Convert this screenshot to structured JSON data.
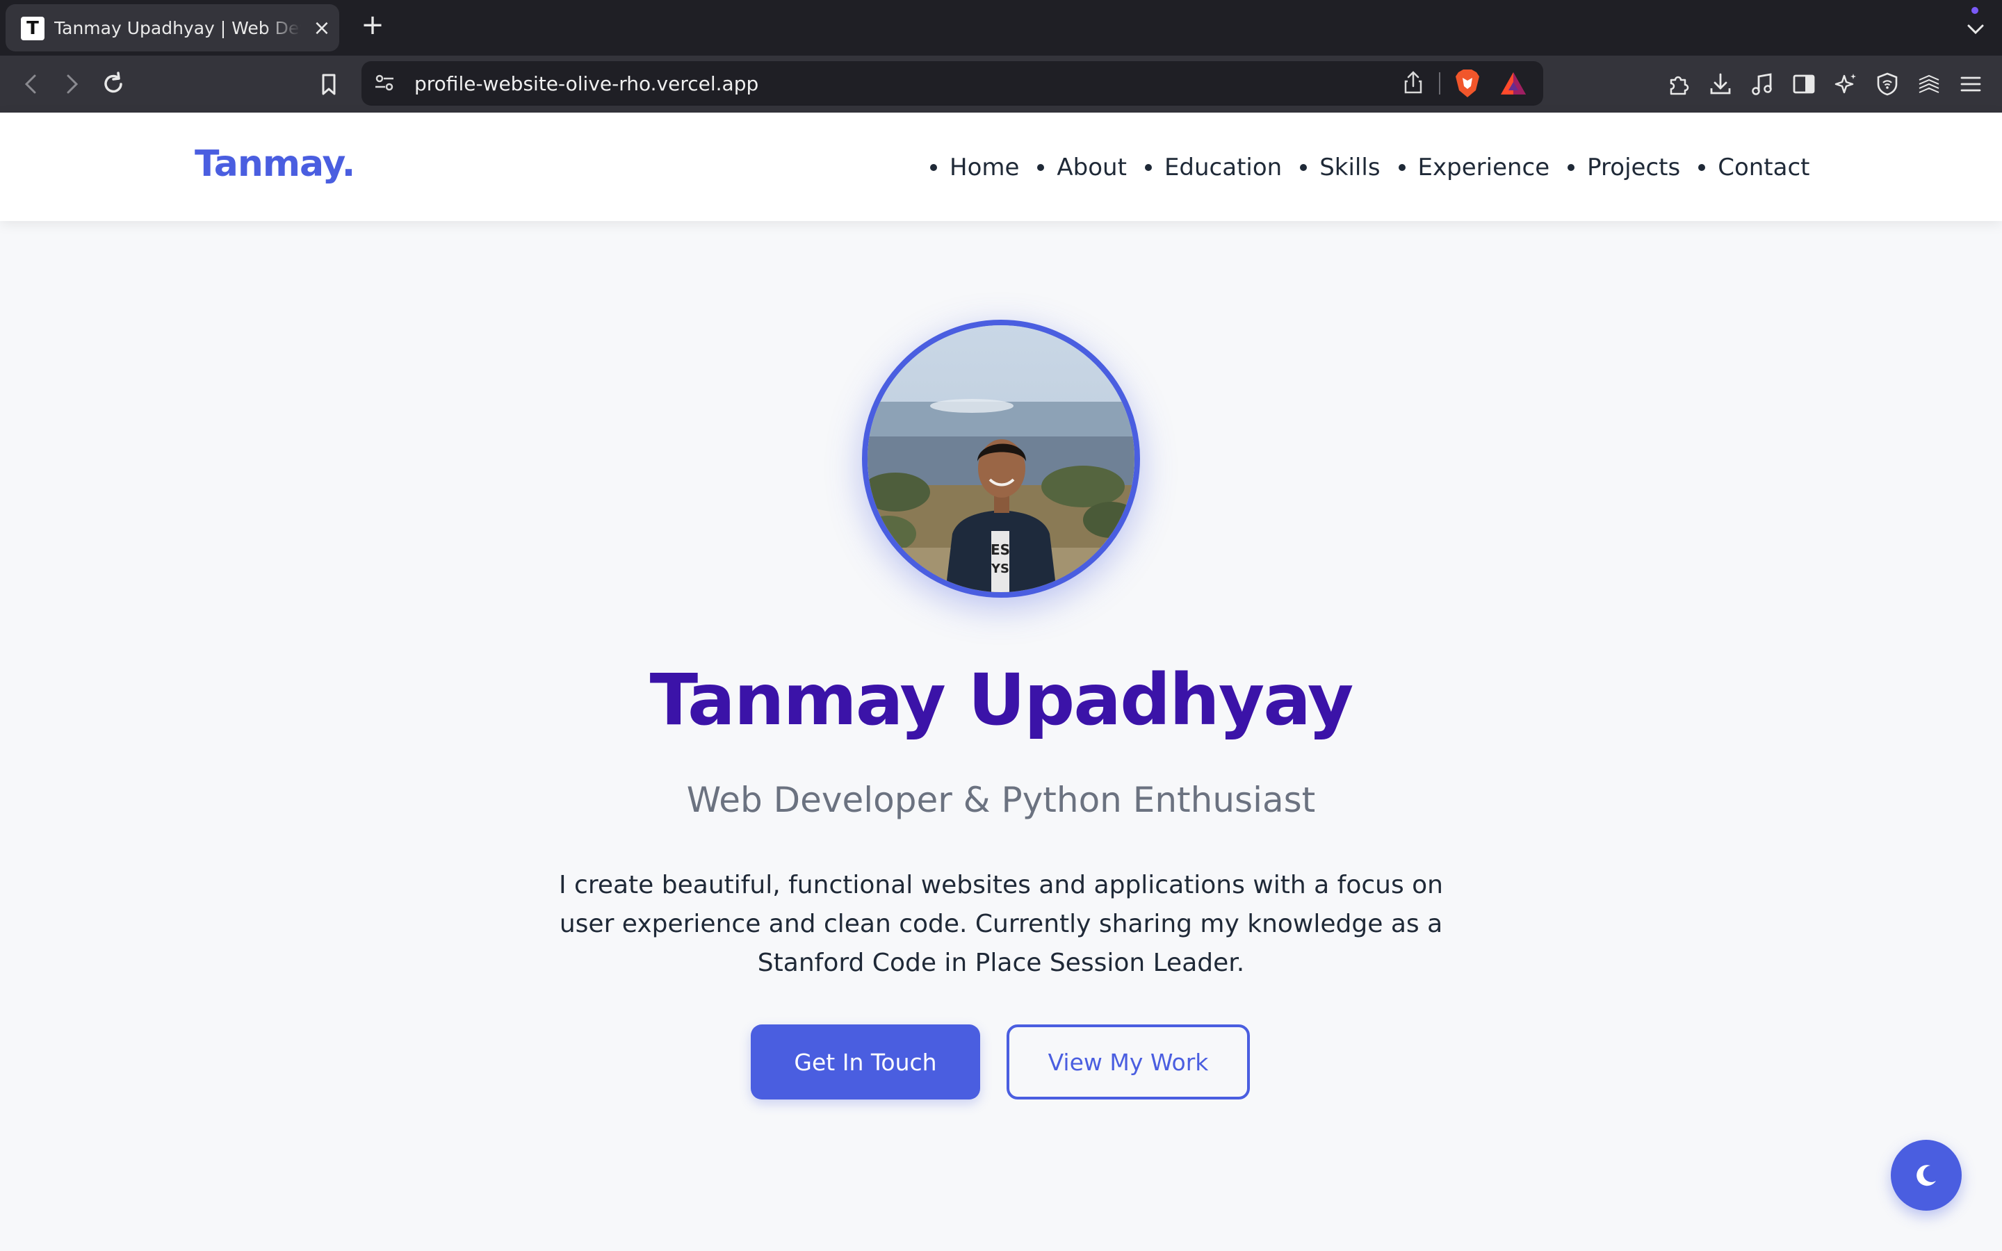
{
  "browser": {
    "tab_title": "Tanmay Upadhyay | Web Developer",
    "favicon_letter": "T",
    "url": "profile-website-olive-rho.vercel.app",
    "accent_dot_color": "#7a5af8"
  },
  "nav": {
    "logo": "Tanmay.",
    "links": [
      "Home",
      "About",
      "Education",
      "Skills",
      "Experience",
      "Projects",
      "Contact"
    ]
  },
  "hero": {
    "name": "Tanmay Upadhyay",
    "subtitle": "Web Developer & Python Enthusiast",
    "description": "I create beautiful, functional websites and applications with a focus on user experience and clean code. Currently sharing my knowledge as a Stanford Code in Place Session Leader.",
    "primary_button": "Get In Touch",
    "secondary_button": "View My Work",
    "avatar_icon": "profile-photo"
  },
  "theme_toggle_icon": "moon-icon",
  "colors": {
    "accent": "#4a5ee0",
    "name": "#3b13a8",
    "subtitle": "#6b7280",
    "background": "#f7f8fa"
  }
}
